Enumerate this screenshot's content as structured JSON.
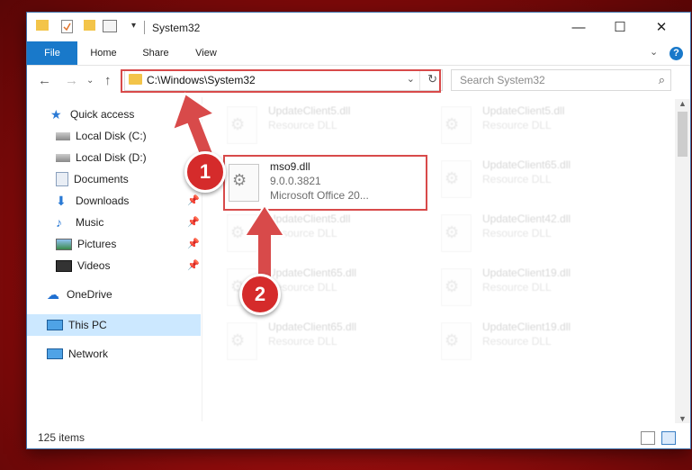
{
  "window": {
    "title": "System32",
    "controls": {
      "minimize": "—",
      "maximize": "☐",
      "close": "✕"
    }
  },
  "ribbon": {
    "tabs": [
      "File",
      "Home",
      "Share",
      "View"
    ],
    "help": "?"
  },
  "address": {
    "path": "C:\\Windows\\System32",
    "search_placeholder": "Search System32"
  },
  "sidebar": {
    "quick_access": "Quick access",
    "items": [
      {
        "label": "Local Disk (C:)",
        "pinned": false
      },
      {
        "label": "Local Disk (D:)",
        "pinned": false
      },
      {
        "label": "Documents",
        "pinned": true
      },
      {
        "label": "Downloads",
        "pinned": true
      },
      {
        "label": "Music",
        "pinned": true
      },
      {
        "label": "Pictures",
        "pinned": true
      },
      {
        "label": "Videos",
        "pinned": true
      }
    ],
    "onedrive": "OneDrive",
    "this_pc": "This PC",
    "network": "Network"
  },
  "files": {
    "selected": {
      "name": "mso9.dll",
      "version": "9.0.0.3821",
      "description": "Microsoft Office 20..."
    },
    "left_column": [
      {
        "name": "UpdateClient5.dll",
        "type": "Resource DLL"
      },
      {
        "name": "UpdateClient5.dll",
        "type": "Resource DLL"
      },
      {
        "name": "UpdateClient65.dll",
        "type": "Resource DLL"
      },
      {
        "name": "UpdateClient65.dll",
        "type": "Resource DLL"
      }
    ],
    "right_column": [
      {
        "name": "UpdateClient5.dll",
        "type": "Resource DLL"
      },
      {
        "name": "UpdateClient65.dll",
        "type": "Resource DLL"
      },
      {
        "name": "UpdateClient42.dll",
        "type": "Resource DLL"
      },
      {
        "name": "UpdateClient19.dll",
        "type": "Resource DLL"
      },
      {
        "name": "UpdateClient19.dll",
        "type": "Resource DLL"
      }
    ]
  },
  "status": {
    "items": "125 items"
  },
  "annotations": {
    "step1": "1",
    "step2": "2",
    "color": "#d84a4a"
  }
}
